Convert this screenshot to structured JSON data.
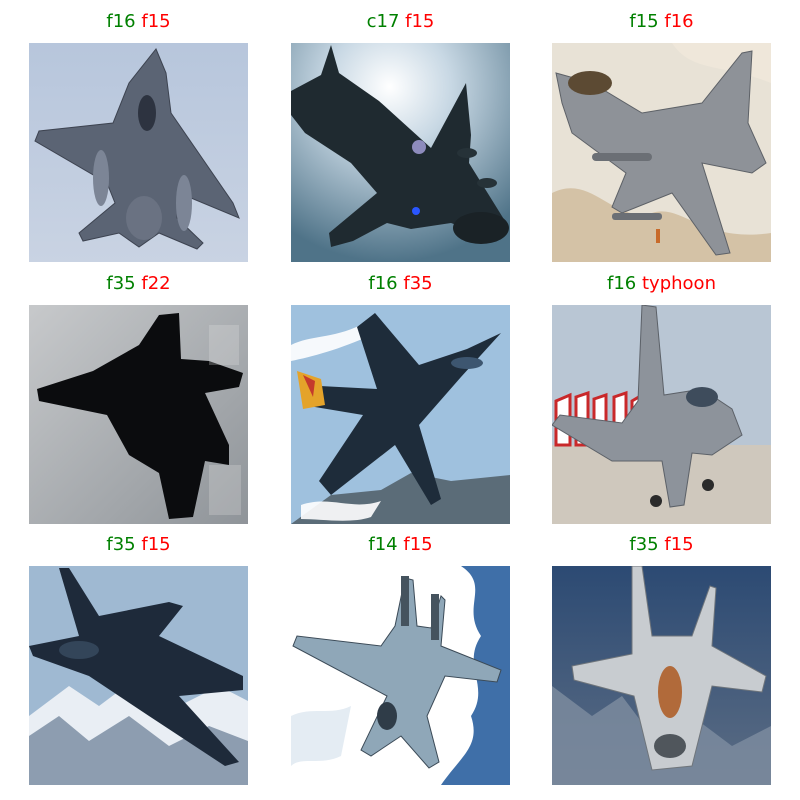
{
  "panels": [
    {
      "true_label": "f16",
      "predicted_label": "f15",
      "colors": {
        "true": "#008000",
        "pred": "#ff0000"
      }
    },
    {
      "true_label": "c17",
      "predicted_label": "f15",
      "colors": {
        "true": "#008000",
        "pred": "#ff0000"
      }
    },
    {
      "true_label": "f15",
      "predicted_label": "f16",
      "colors": {
        "true": "#008000",
        "pred": "#ff0000"
      }
    },
    {
      "true_label": "f35",
      "predicted_label": "f22",
      "colors": {
        "true": "#008000",
        "pred": "#ff0000"
      }
    },
    {
      "true_label": "f16",
      "predicted_label": "f35",
      "colors": {
        "true": "#008000",
        "pred": "#ff0000"
      }
    },
    {
      "true_label": "f16",
      "predicted_label": "typhoon",
      "colors": {
        "true": "#008000",
        "pred": "#ff0000"
      }
    },
    {
      "true_label": "f35",
      "predicted_label": "f15",
      "colors": {
        "true": "#008000",
        "pred": "#ff0000"
      }
    },
    {
      "true_label": "f14",
      "predicted_label": "f15",
      "colors": {
        "true": "#008000",
        "pred": "#ff0000"
      }
    },
    {
      "true_label": "f35",
      "predicted_label": "f15",
      "colors": {
        "true": "#008000",
        "pred": "#ff0000"
      }
    }
  ]
}
